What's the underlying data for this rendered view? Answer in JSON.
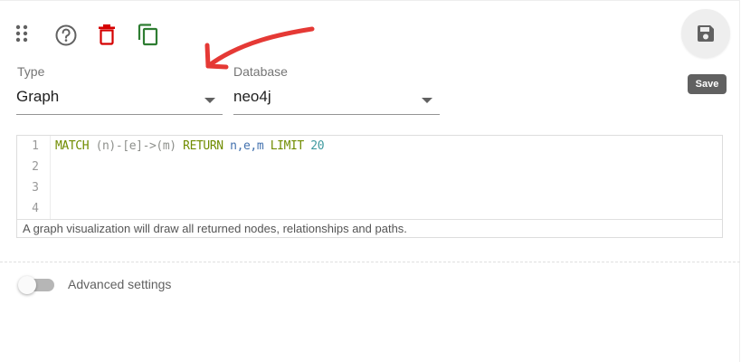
{
  "toolbar": {
    "icons": [
      "drag-handle-icon",
      "help-icon",
      "delete-icon",
      "copy-icon"
    ],
    "colors": {
      "default": "#616161",
      "delete": "#d50000",
      "copy": "#2e7d32"
    }
  },
  "annotation": {
    "color": "#e53935"
  },
  "form": {
    "type": {
      "label": "Type",
      "value": "Graph"
    },
    "database": {
      "label": "Database",
      "value": "neo4j"
    }
  },
  "save": {
    "icon": "floppy-disk-icon",
    "tooltip": "Save"
  },
  "editor": {
    "line_numbers": [
      "1",
      "2",
      "3",
      "4"
    ],
    "query_tokens": [
      {
        "text": "MATCH",
        "color": "#708c00"
      },
      {
        "text": " ",
        "color": "#4d4d4c"
      },
      {
        "text": "(n)-[e]->(m)",
        "color": "#8e908c"
      },
      {
        "text": " ",
        "color": "#4d4d4c"
      },
      {
        "text": "RETURN",
        "color": "#708c00"
      },
      {
        "text": " ",
        "color": "#4d4d4c"
      },
      {
        "text": "n,e,m",
        "color": "#4271ae"
      },
      {
        "text": " ",
        "color": "#4d4d4c"
      },
      {
        "text": "LIMIT",
        "color": "#708c00"
      },
      {
        "text": " ",
        "color": "#4d4d4c"
      },
      {
        "text": "20",
        "color": "#3e999f"
      }
    ],
    "help_text": "A graph visualization will draw all returned nodes, relationships and paths."
  },
  "advanced": {
    "label": "Advanced settings",
    "enabled": false
  }
}
